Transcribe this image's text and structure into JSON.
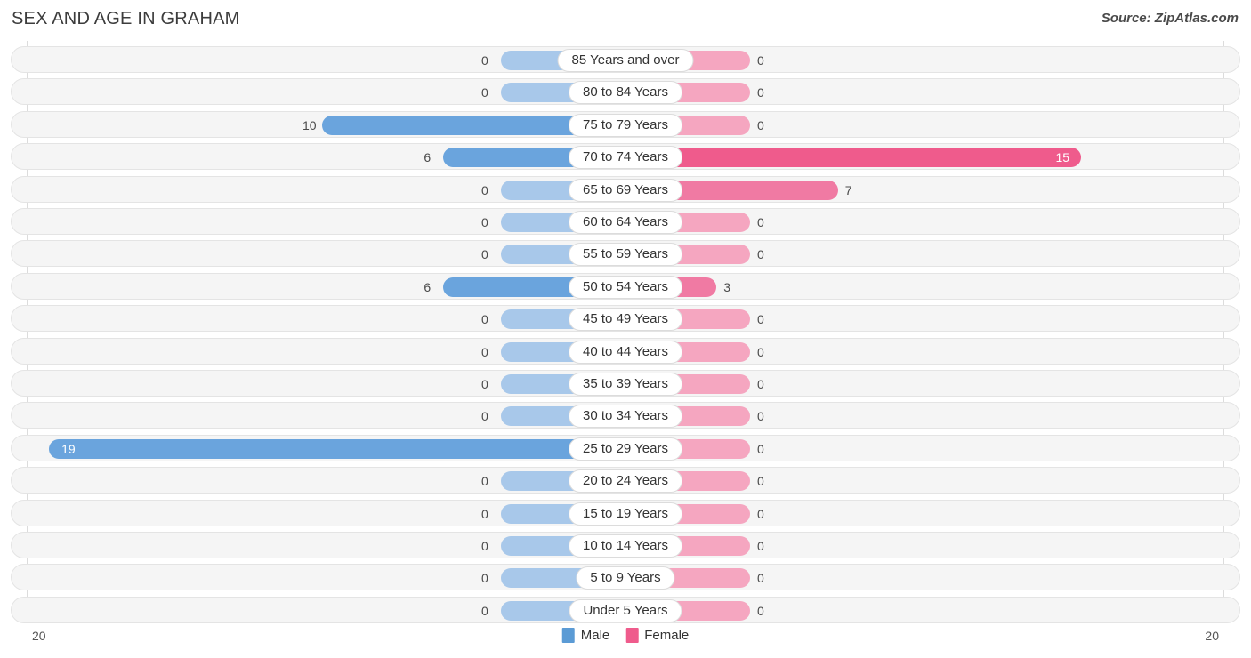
{
  "header": {
    "title": "SEX AND AGE IN GRAHAM",
    "source": "Source: ZipAtlas.com"
  },
  "legend": {
    "male_label": "Male",
    "female_label": "Female",
    "male_color": "#5b9bd5",
    "female_color": "#ef5b8c"
  },
  "axis": {
    "left_tick": "20",
    "right_tick": "20",
    "max": 20
  },
  "colors": {
    "male_active": "#6aa4dd",
    "male_zero": "#a8c8ea",
    "female_active": "#f07aa3",
    "female_high": "#ef5b8c",
    "female_zero": "#f5a6c0",
    "track_bg": "#f5f5f5",
    "track_border": "#e4e4e4"
  },
  "chart_data": {
    "type": "bar",
    "title": "SEX AND AGE IN GRAHAM",
    "xlabel": "",
    "ylabel": "",
    "xlim": [
      20,
      20
    ],
    "grid": false,
    "legend_position": "bottom-center",
    "categories": [
      "85 Years and over",
      "80 to 84 Years",
      "75 to 79 Years",
      "70 to 74 Years",
      "65 to 69 Years",
      "60 to 64 Years",
      "55 to 59 Years",
      "50 to 54 Years",
      "45 to 49 Years",
      "40 to 44 Years",
      "35 to 39 Years",
      "30 to 34 Years",
      "25 to 29 Years",
      "20 to 24 Years",
      "15 to 19 Years",
      "10 to 14 Years",
      "5 to 9 Years",
      "Under 5 Years"
    ],
    "series": [
      {
        "name": "Male",
        "values": [
          0,
          0,
          10,
          6,
          0,
          0,
          0,
          6,
          0,
          0,
          0,
          0,
          19,
          0,
          0,
          0,
          0,
          0
        ]
      },
      {
        "name": "Female",
        "values": [
          0,
          0,
          0,
          15,
          7,
          0,
          0,
          3,
          0,
          0,
          0,
          0,
          0,
          0,
          0,
          0,
          0,
          0
        ]
      }
    ]
  },
  "rows": [
    {
      "label": "85 Years and over",
      "male": "0",
      "female": "0"
    },
    {
      "label": "80 to 84 Years",
      "male": "0",
      "female": "0"
    },
    {
      "label": "75 to 79 Years",
      "male": "10",
      "female": "0"
    },
    {
      "label": "70 to 74 Years",
      "male": "6",
      "female": "15"
    },
    {
      "label": "65 to 69 Years",
      "male": "0",
      "female": "7"
    },
    {
      "label": "60 to 64 Years",
      "male": "0",
      "female": "0"
    },
    {
      "label": "55 to 59 Years",
      "male": "0",
      "female": "0"
    },
    {
      "label": "50 to 54 Years",
      "male": "6",
      "female": "3"
    },
    {
      "label": "45 to 49 Years",
      "male": "0",
      "female": "0"
    },
    {
      "label": "40 to 44 Years",
      "male": "0",
      "female": "0"
    },
    {
      "label": "35 to 39 Years",
      "male": "0",
      "female": "0"
    },
    {
      "label": "30 to 34 Years",
      "male": "0",
      "female": "0"
    },
    {
      "label": "25 to 29 Years",
      "male": "19",
      "female": "0"
    },
    {
      "label": "20 to 24 Years",
      "male": "0",
      "female": "0"
    },
    {
      "label": "15 to 19 Years",
      "male": "0",
      "female": "0"
    },
    {
      "label": "10 to 14 Years",
      "male": "0",
      "female": "0"
    },
    {
      "label": "5 to 9 Years",
      "male": "0",
      "female": "0"
    },
    {
      "label": "Under 5 Years",
      "male": "0",
      "female": "0"
    }
  ]
}
